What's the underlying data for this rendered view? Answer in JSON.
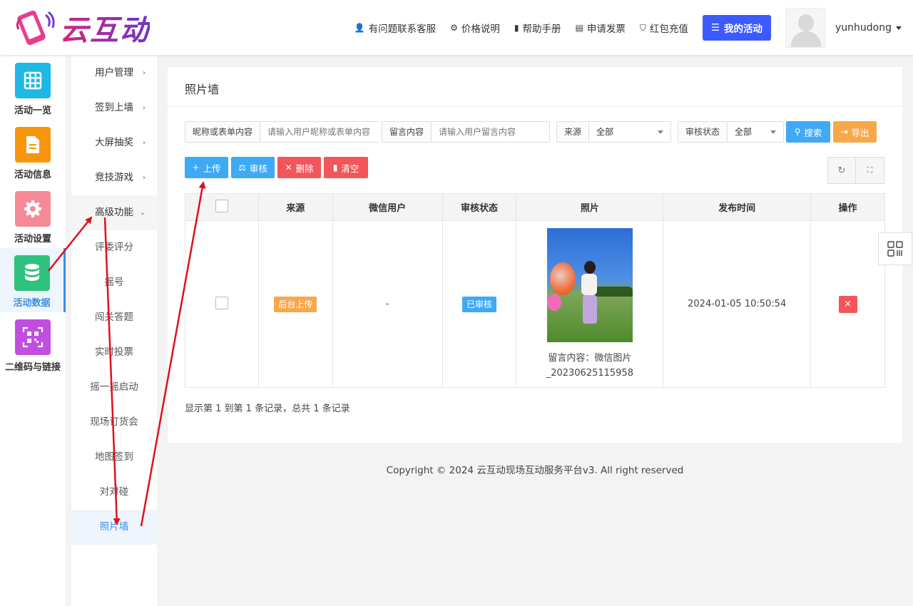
{
  "brand": {
    "name": "云互动"
  },
  "topnav": {
    "items": [
      {
        "icon": "user-plus-icon",
        "label": "有问题联系客服"
      },
      {
        "icon": "gear-icon",
        "label": "价格说明"
      },
      {
        "icon": "book-icon",
        "label": "帮助手册"
      },
      {
        "icon": "printer-icon",
        "label": "申请发票"
      },
      {
        "icon": "shield-check-icon",
        "label": "红包充值"
      }
    ],
    "my_activity": "我的活动",
    "username": "yunhudong"
  },
  "rail": {
    "items": [
      {
        "label": "活动一览",
        "color": "#1eb8e6",
        "icon": "grid-icon"
      },
      {
        "label": "活动信息",
        "color": "#f7960a",
        "icon": "document-icon"
      },
      {
        "label": "活动设置",
        "color": "#f58a97",
        "icon": "gear-icon"
      },
      {
        "label": "活动数据",
        "color": "#2ec27e",
        "icon": "database-icon",
        "active": true
      },
      {
        "label": "二维码与链接",
        "color": "#c14ee0",
        "icon": "qrcode-icon"
      }
    ]
  },
  "submenu": {
    "items": [
      {
        "label": "用户管理",
        "chevron": "›"
      },
      {
        "label": "签到上墙",
        "chevron": "›"
      },
      {
        "label": "大屏抽奖",
        "chevron": "›"
      },
      {
        "label": "竞技游戏",
        "chevron": "›"
      },
      {
        "label": "高级功能",
        "chevron": "⌄",
        "open": true
      },
      {
        "label": "评委评分"
      },
      {
        "label": "摇号"
      },
      {
        "label": "闯关答题"
      },
      {
        "label": "实时投票"
      },
      {
        "label": "摇一摇启动"
      },
      {
        "label": "现场订货会"
      },
      {
        "label": "地图签到"
      },
      {
        "label": "对对碰"
      },
      {
        "label": "照片墙",
        "active": true
      }
    ]
  },
  "panel": {
    "title": "照片墙",
    "filters": {
      "nickname_label": "昵称或表单内容",
      "nickname_placeholder": "请输入用户昵称或表单内容",
      "message_label": "留言内容",
      "message_placeholder": "请输入用户留言内容",
      "source_label": "来源",
      "source_value": "全部",
      "status_label": "审核状态",
      "status_value": "全部",
      "search": "搜索",
      "export": "导出"
    },
    "actions": {
      "upload": "上传",
      "review": "审核",
      "delete": "删除",
      "clear": "清空"
    },
    "table": {
      "headers": [
        "来源",
        "微信用户",
        "审核状态",
        "照片",
        "发布时间",
        "操作"
      ],
      "rows": [
        {
          "source": "后台上传",
          "wechat_user": "-",
          "status": "已审核",
          "caption": "留言内容：微信图片_20230625115958",
          "time": "2024-01-05 10:50:54",
          "op": "×"
        }
      ]
    },
    "pager": "显示第 1 到第 1 条记录，总共 1 条记录"
  },
  "footer": "Copyright © 2024 云互动现场互动服务平台v3. All right reserved",
  "colors": {
    "primary": "#3d5afe",
    "info": "#3fa9f5",
    "danger": "#f2555a",
    "warning": "#f7a84a",
    "success": "#2ec27e",
    "annotation": "#e0101e"
  }
}
